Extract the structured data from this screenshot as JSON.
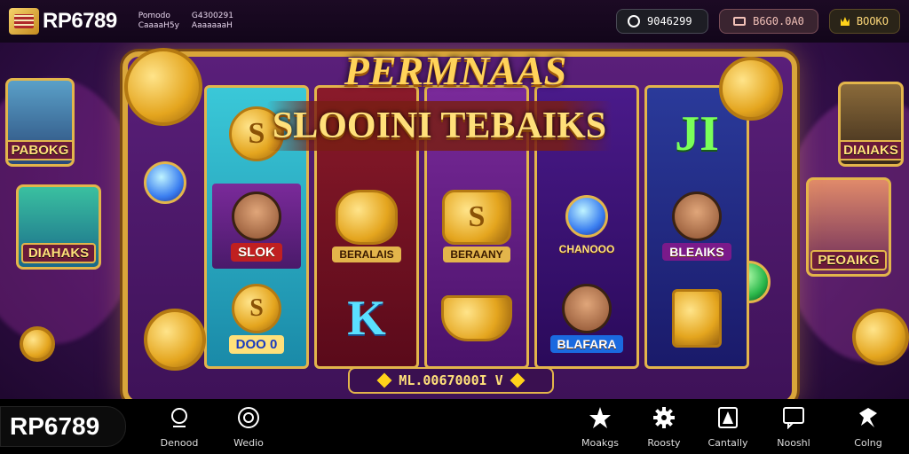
{
  "topbar": {
    "brand": "RP6789",
    "info_left": [
      "Pomodo",
      "CaaaaH5y"
    ],
    "info_right": [
      "G4300291",
      "AaaaaaaH"
    ],
    "balance": "9046299",
    "deposit": "B6G0.0A0",
    "bonus_label": "BOOKO"
  },
  "game": {
    "title_top": "PERMNAAS",
    "title_banner": "SLOOINI TEBAIKS",
    "win_line": "ML.0067000I V",
    "reels": [
      {
        "top": "S",
        "mid_label": "SLOK",
        "bottom_text": "DOO 0"
      },
      {
        "top": "",
        "mid_label": "BERALAIS",
        "bottom_text": "K"
      },
      {
        "top": "",
        "mid_label": "BERAANY",
        "bottom_text": ""
      },
      {
        "top": "",
        "mid_label": "CHANOOO",
        "bottom_text": "BLAFARA"
      },
      {
        "top": "JI",
        "mid_label": "BLEAIKS",
        "bottom_text": ""
      }
    ],
    "side_cards": [
      {
        "label": "PABOKG"
      },
      {
        "label": "DIAHAKS"
      },
      {
        "label": "DIAIAKS"
      },
      {
        "label": "PEOAIKG"
      }
    ]
  },
  "bottombar": {
    "brand": "RP6789",
    "nav": [
      {
        "label": "Denood",
        "icon": "user-icon"
      },
      {
        "label": "Wedio",
        "icon": "badge-icon"
      },
      {
        "label": "Moakgs",
        "icon": "star-icon"
      },
      {
        "label": "Roosty",
        "icon": "gear-icon"
      },
      {
        "label": "Cantally",
        "icon": "card-icon"
      },
      {
        "label": "Nooshl",
        "icon": "chat-icon"
      },
      {
        "label": "Colng",
        "icon": "tag-icon"
      }
    ]
  },
  "colors": {
    "gold": "#e3b54b",
    "purple": "#3e1258",
    "accent": "#ffd35a"
  }
}
